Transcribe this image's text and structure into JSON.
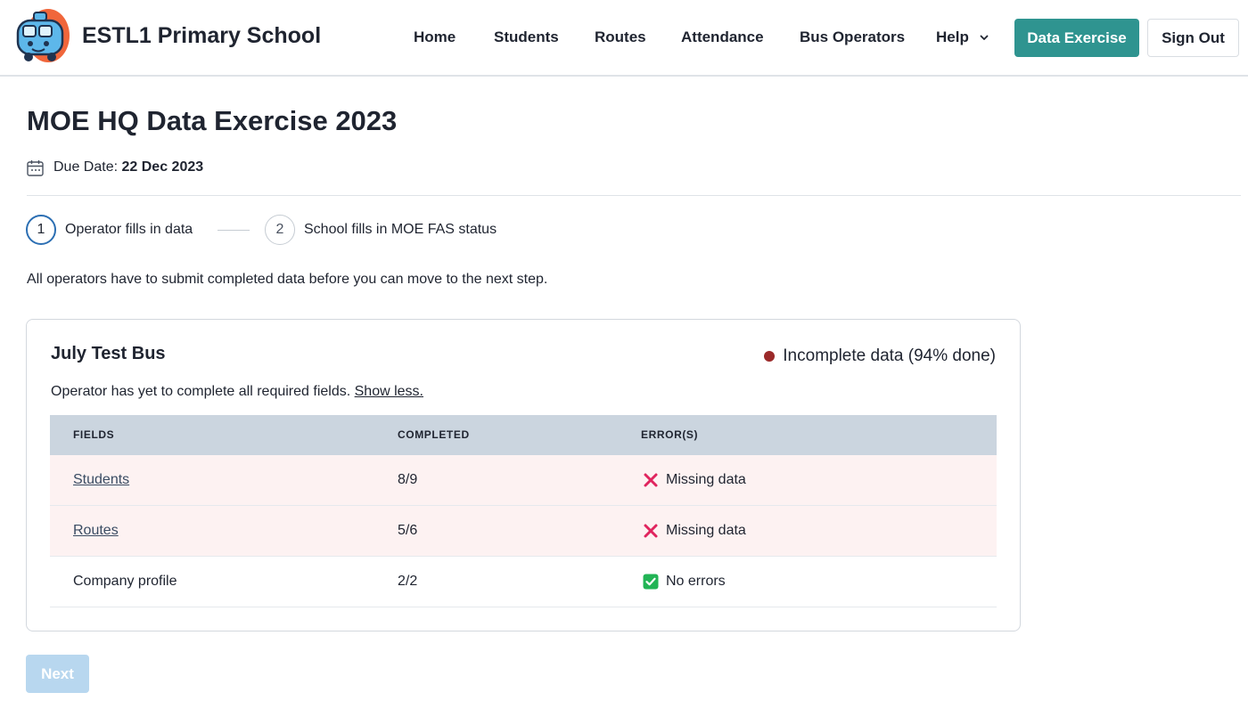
{
  "header": {
    "brand": "ESTL1 Primary School",
    "nav": [
      {
        "label": "Home"
      },
      {
        "label": "Students"
      },
      {
        "label": "Routes"
      },
      {
        "label": "Attendance"
      },
      {
        "label": "Bus Operators"
      },
      {
        "label": "Help"
      }
    ],
    "primary_button": "Data Exercise",
    "signout_button": "Sign Out"
  },
  "page": {
    "title": "MOE HQ Data Exercise 2023",
    "due_label": "Due Date:",
    "due_value": "22 Dec 2023",
    "info": "All operators have to submit completed data before you can move to the next step."
  },
  "stepper": [
    {
      "number": "1",
      "label": "Operator fills in data"
    },
    {
      "number": "2",
      "label": "School fills in MOE FAS status"
    }
  ],
  "operator": {
    "name": "July Test Bus",
    "status": "Incomplete data (94% done)",
    "note": "Operator has yet to complete all required fields.",
    "note_link": "Show less.",
    "table": {
      "headers": [
        "FIELDS",
        "COMPLETED",
        "ERROR(S)"
      ],
      "rows": [
        {
          "field": "Students",
          "completed": "8/9",
          "error": "Missing data"
        },
        {
          "field": "Routes",
          "completed": "5/6",
          "error": "Missing data"
        },
        {
          "field": "Company profile",
          "completed": "2/2",
          "error": "No errors"
        }
      ]
    }
  },
  "footer": {
    "next_button": "Next"
  },
  "colors": {
    "accent": "#2f9490",
    "status_incomplete": "#9b2a2a",
    "error_row_bg": "#fdf2f2",
    "error_icon": "#e0245e",
    "ok_icon": "#22b455",
    "next_disabled": "#b8d7ef"
  }
}
